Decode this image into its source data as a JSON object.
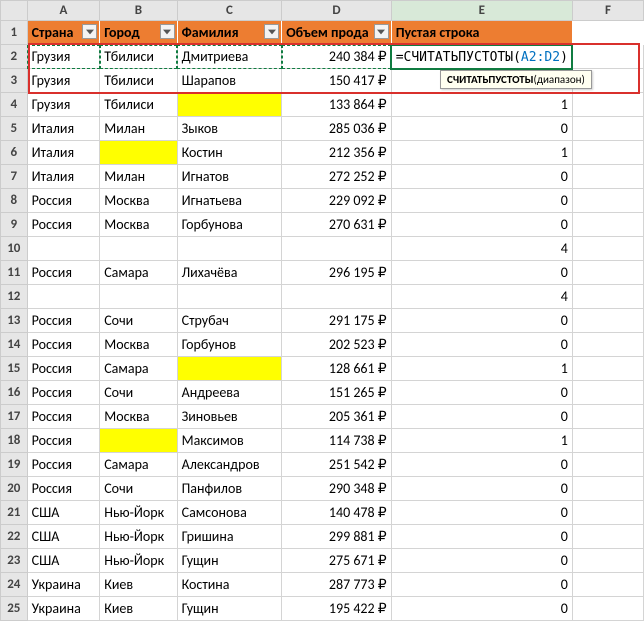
{
  "columns": [
    "A",
    "B",
    "C",
    "D",
    "E",
    "F"
  ],
  "active_column": "E",
  "headers": {
    "country": "Страна",
    "city": "Город",
    "surname": "Фамилия",
    "sales": "Объем прода",
    "empty": "Пустая строка"
  },
  "formula": {
    "prefix": "=СЧИТАТЬПУСТОТЫ(",
    "ref": "A2:D2",
    "suffix": ")"
  },
  "tooltip": {
    "fn": "СЧИТАТЬПУСТОТЫ",
    "arg": "(диапазон)"
  },
  "rows": [
    {
      "n": 2,
      "country": "Грузия",
      "city": "Тбилиси",
      "surname": "Дмитриева",
      "sales": "240 384 ₽",
      "e": "formula"
    },
    {
      "n": 3,
      "country": "Грузия",
      "city": "Тбилиси",
      "surname": "Шарапов",
      "sales": "150 417 ₽",
      "e": ""
    },
    {
      "n": 4,
      "country": "Грузия",
      "city": "Тбилиси",
      "surname": "",
      "sales": "133 864 ₽",
      "e": "1",
      "hl": "surname"
    },
    {
      "n": 5,
      "country": "Италия",
      "city": "Милан",
      "surname": "Зыков",
      "sales": "285 036 ₽",
      "e": "0"
    },
    {
      "n": 6,
      "country": "Италия",
      "city": "",
      "surname": "Костин",
      "sales": "212 356 ₽",
      "e": "1",
      "hl": "city"
    },
    {
      "n": 7,
      "country": "Италия",
      "city": "Милан",
      "surname": "Игнатов",
      "sales": "272 252 ₽",
      "e": "0"
    },
    {
      "n": 8,
      "country": "Россия",
      "city": "Москва",
      "surname": "Игнатьева",
      "sales": "229 092 ₽",
      "e": "0"
    },
    {
      "n": 9,
      "country": "Россия",
      "city": "Москва",
      "surname": "Горбунова",
      "sales": "270 631 ₽",
      "e": "0"
    },
    {
      "n": 10,
      "country": "",
      "city": "",
      "surname": "",
      "sales": "",
      "e": "4"
    },
    {
      "n": 11,
      "country": "Россия",
      "city": "Самара",
      "surname": "Лихачёва",
      "sales": "296 195 ₽",
      "e": "0"
    },
    {
      "n": 12,
      "country": "",
      "city": "",
      "surname": "",
      "sales": "",
      "e": "4"
    },
    {
      "n": 13,
      "country": "Россия",
      "city": "Сочи",
      "surname": "Струбач",
      "sales": "291 175 ₽",
      "e": "0"
    },
    {
      "n": 14,
      "country": "Россия",
      "city": "Москва",
      "surname": "Горбунов",
      "sales": "202 523 ₽",
      "e": "0"
    },
    {
      "n": 15,
      "country": "Россия",
      "city": "Самара",
      "surname": "",
      "sales": "128 661 ₽",
      "e": "1",
      "hl": "surname"
    },
    {
      "n": 16,
      "country": "Россия",
      "city": "Сочи",
      "surname": "Андреева",
      "sales": "151 265 ₽",
      "e": "0"
    },
    {
      "n": 17,
      "country": "Россия",
      "city": "Москва",
      "surname": "Зиновьев",
      "sales": "205 361 ₽",
      "e": "0"
    },
    {
      "n": 18,
      "country": "Россия",
      "city": "",
      "surname": "Максимов",
      "sales": "114 738 ₽",
      "e": "1",
      "hl": "city"
    },
    {
      "n": 19,
      "country": "Россия",
      "city": "Самара",
      "surname": "Александров",
      "sales": "251 542 ₽",
      "e": "0"
    },
    {
      "n": 20,
      "country": "Россия",
      "city": "Сочи",
      "surname": "Панфилов",
      "sales": "290 348 ₽",
      "e": "0"
    },
    {
      "n": 21,
      "country": "США",
      "city": "Нью-Йорк",
      "surname": "Самсонова",
      "sales": "140 478 ₽",
      "e": "0"
    },
    {
      "n": 22,
      "country": "США",
      "city": "Нью-Йорк",
      "surname": "Гришина",
      "sales": "299 881 ₽",
      "e": "0"
    },
    {
      "n": 23,
      "country": "США",
      "city": "Нью-Йорк",
      "surname": "Гущин",
      "sales": "275 671 ₽",
      "e": "0"
    },
    {
      "n": 24,
      "country": "Украина",
      "city": "Киев",
      "surname": "Костина",
      "sales": "287 773 ₽",
      "e": "0"
    },
    {
      "n": 25,
      "country": "Украина",
      "city": "Киев",
      "surname": "Гущин",
      "sales": "195 422 ₽",
      "e": "0"
    }
  ]
}
